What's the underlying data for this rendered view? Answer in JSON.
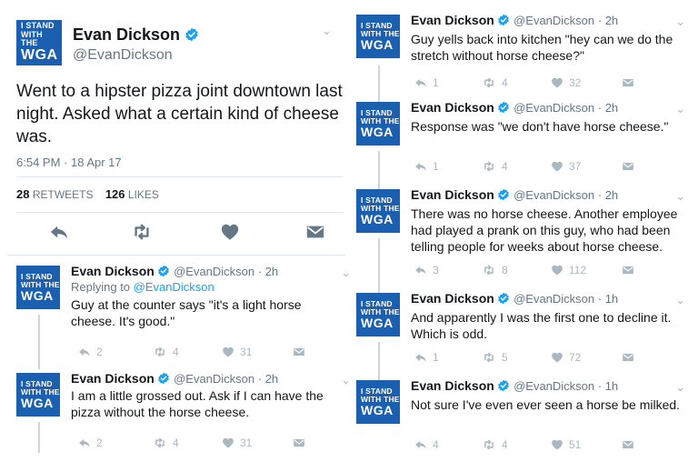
{
  "avatar": {
    "line1": "I STAND",
    "line2": "WITH THE",
    "line3": "WGA"
  },
  "main": {
    "name": "Evan Dickson",
    "handle": "@EvanDickson",
    "text": "Went to a hipster pizza joint downtown last night. Asked what a certain kind of cheese was.",
    "time": "6:54 PM · 18 Apr 17",
    "retweets_count": "28",
    "retweets_label": "RETWEETS",
    "likes_count": "126",
    "likes_label": "LIKES"
  },
  "left_replies": [
    {
      "name": "Evan Dickson",
      "handle": "@EvanDickson · 2h",
      "replying_prefix": "Replying to ",
      "replying_to": "@EvanDickson",
      "text": "Guy at the counter says \"it's a light horse cheese. It's good.\"",
      "replies": "2",
      "retweets": "4",
      "likes": "31"
    },
    {
      "name": "Evan Dickson",
      "handle": "@EvanDickson · 2h",
      "text": "I am a little grossed out. Ask if I can have the pizza without the horse cheese.",
      "replies": "2",
      "retweets": "4",
      "likes": "31"
    }
  ],
  "right_replies": [
    {
      "name": "Evan Dickson",
      "handle": "@EvanDickson · 2h",
      "text": "Guy yells back into kitchen \"hey can we do the stretch without horse cheese?\"",
      "replies": "1",
      "retweets": "4",
      "likes": "32"
    },
    {
      "name": "Evan Dickson",
      "handle": "@EvanDickson · 2h",
      "text": "Response was \"we don't have horse cheese.\"",
      "replies": "1",
      "retweets": "4",
      "likes": "37"
    },
    {
      "name": "Evan Dickson",
      "handle": "@EvanDickson · 2h",
      "text": "There was no horse cheese. Another employee had played a prank on this guy, who had been telling people for weeks about horse cheese.",
      "replies": "3",
      "retweets": "8",
      "likes": "112"
    },
    {
      "name": "Evan Dickson",
      "handle": "@EvanDickson · 1h",
      "text": "And apparently I was the first one to decline it. Which is odd.",
      "replies": "1",
      "retweets": "5",
      "likes": "72"
    },
    {
      "name": "Evan Dickson",
      "handle": "@EvanDickson · 1h",
      "text": "Not sure I've even ever seen a horse be milked.",
      "replies": "4",
      "retweets": "4",
      "likes": "51"
    }
  ],
  "icons": {
    "verified": "verified-badge-icon",
    "reply": "reply-arrow-icon",
    "retweet": "retweet-icon",
    "like": "heart-icon",
    "message": "envelope-icon",
    "more": "chevron-down-icon"
  },
  "colors": {
    "avatar_bg": "#1b5fb0",
    "verified": "#1da1f2",
    "link": "#1da1f2",
    "muted": "#657786",
    "action_icons": "#aab8c2"
  }
}
